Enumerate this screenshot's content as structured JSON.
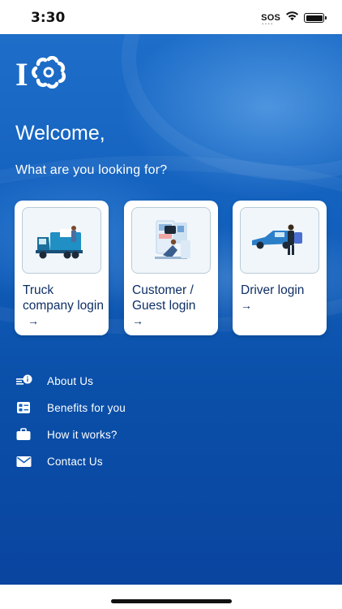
{
  "status_bar": {
    "time": "3:30",
    "sos": "SOS",
    "battery_level": 1.0
  },
  "logo": {
    "letter": "I"
  },
  "header": {
    "welcome": "Welcome,",
    "subtitle": "What are you looking for?"
  },
  "cards": [
    {
      "label": "Truck company login",
      "icon": "truck-illustration",
      "arrow": "→"
    },
    {
      "label": "Customer / Guest login",
      "icon": "customer-illustration",
      "arrow": "→"
    },
    {
      "label": "Driver login",
      "icon": "driver-illustration",
      "arrow": "→"
    }
  ],
  "menu": [
    {
      "label": "About Us",
      "icon": "about-icon"
    },
    {
      "label": "Benefits for you",
      "icon": "benefits-icon"
    },
    {
      "label": "How it works?",
      "icon": "briefcase-icon"
    },
    {
      "label": "Contact Us",
      "icon": "mail-icon"
    }
  ],
  "colors": {
    "background_top": "#1e6ec9",
    "background_bottom": "#0a45a0",
    "card_text": "#0e2f66",
    "card_background": "#ffffff"
  }
}
